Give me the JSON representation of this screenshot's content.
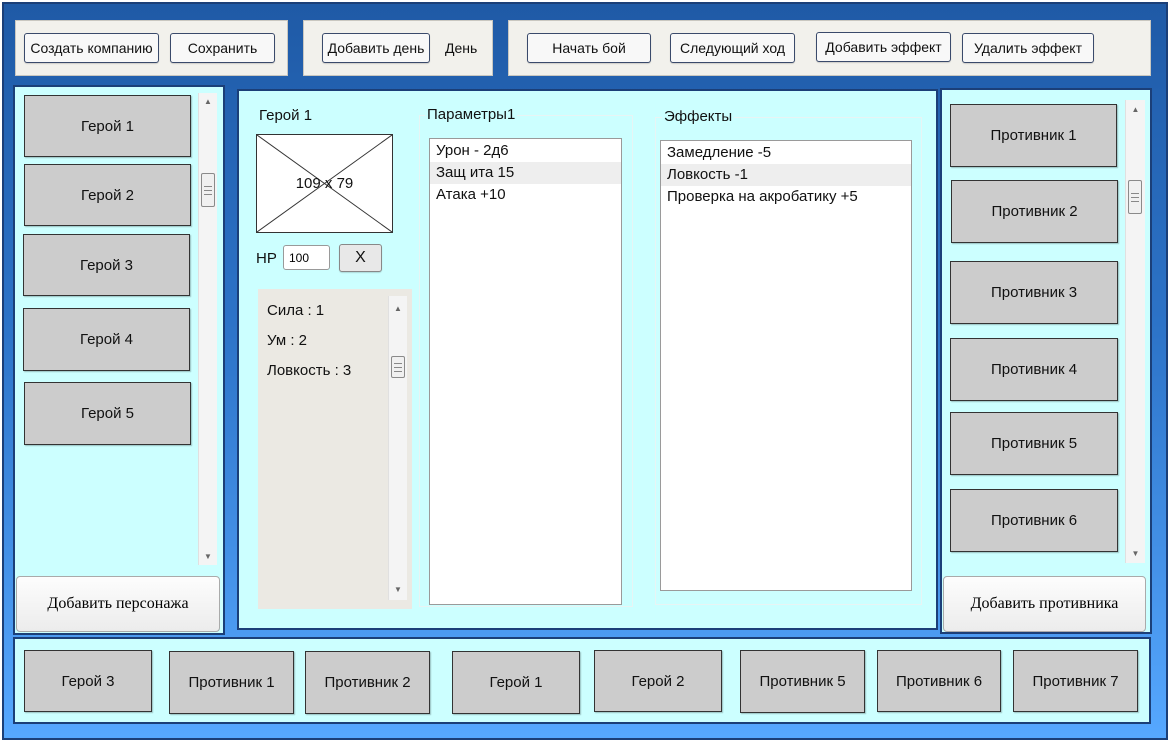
{
  "toolbar": {
    "create_company": "Создать компанию",
    "save": "Сохранить",
    "add_day": "Добавить день",
    "day_label": "День",
    "start_battle": "Начать бой",
    "next_turn": "Следующий ход",
    "add_effect": "Добавить эффект",
    "remove_effect": "Удалить эффект"
  },
  "heroes": {
    "items": [
      "Герой 1",
      "Герой 2",
      "Герой 3",
      "Герой 4",
      "Герой 5"
    ],
    "add_button": "Добавить персонажа"
  },
  "enemies": {
    "items": [
      "Противник 1",
      "Противник 2",
      "Противник 3",
      "Противник 4",
      "Противник 5",
      "Противник 6"
    ],
    "add_button": "Добавить противника"
  },
  "detail": {
    "hero_name": "Герой 1",
    "image_placeholder": "109 x 79",
    "hp_label": "HP",
    "hp_value": "100",
    "close_label": "X",
    "stats": [
      "Сила : 1",
      "Ум : 2",
      "Ловкость : 3"
    ],
    "params_title": "Параметры1",
    "params": [
      "Урон - 2д6",
      "Защ ита 15",
      "Атака +10"
    ],
    "params_selected_index": 1,
    "effects_title": "Эффекты",
    "effects": [
      "Замедление -5",
      "Ловкость -1",
      "Проверка на акробатику +5"
    ],
    "effects_selected_index": 1
  },
  "turn_order": [
    "Герой 3",
    "Противник 1",
    "Противник 2",
    "Герой 1",
    "Герой 2",
    "Противник 5",
    "Противник 6",
    "Противник 7"
  ],
  "colors": {
    "panel_bg": "#ccffff",
    "card_bg": "#cccccc",
    "frame_dark": "#1b3f78"
  }
}
